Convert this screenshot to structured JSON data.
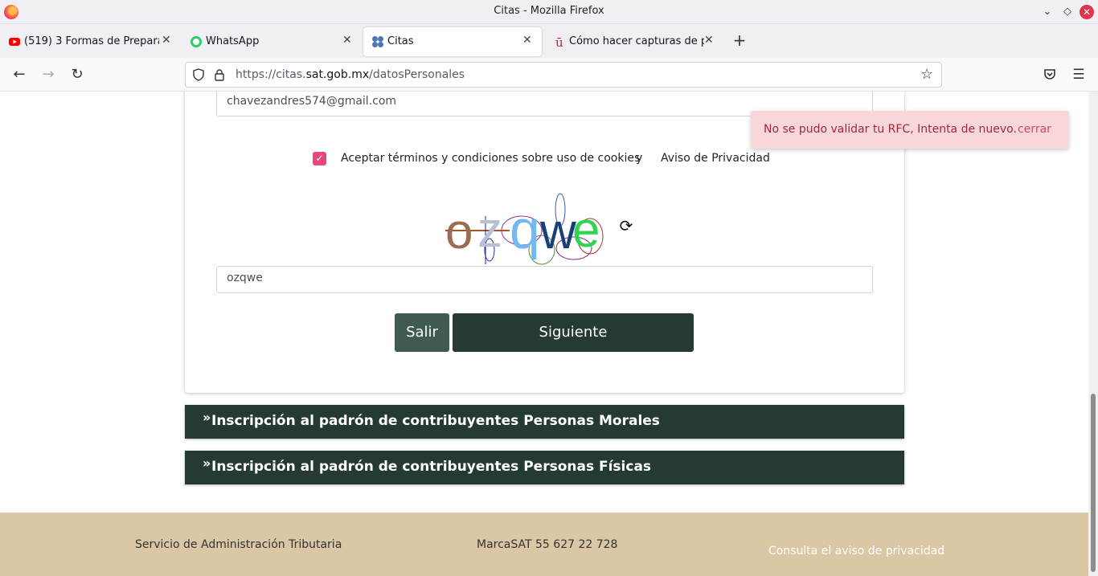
{
  "window": {
    "title": "Citas - Mozilla Firefox"
  },
  "tabs": [
    {
      "label": "(519) 3 Formas de Prepara",
      "icon": "youtube-icon"
    },
    {
      "label": "WhatsApp",
      "icon": "whatsapp-icon"
    },
    {
      "label": "Citas",
      "icon": "citas-icon",
      "active": true
    },
    {
      "label": "Cómo hacer capturas de p",
      "icon": "site-icon"
    }
  ],
  "urlbar": {
    "prefix": "https://citas.",
    "domain": "sat.gob.mx",
    "path": "/datosPersonales"
  },
  "form": {
    "email_value": "chavezandres574@gmail.com",
    "terms_text": "Aceptar términos y condiciones sobre uso de cookies",
    "terms_connector": "y",
    "privacy_link": "Aviso de Privacidad",
    "captcha_text": "ozqwe",
    "captcha_value": "ozqwe",
    "salir_label": "Salir",
    "siguiente_label": "Siguiente"
  },
  "accordions": [
    {
      "label": "Inscripción al padrón de contribuyentes Personas Morales"
    },
    {
      "label": "Inscripción al padrón de contribuyentes Personas Físicas"
    }
  ],
  "footer": {
    "org": "Servicio de Administración Tributaria",
    "phone": "MarcaSAT 55 627 22 728",
    "privacy": "Consulta el aviso de privacidad"
  },
  "toast": {
    "message": "No se pudo validar tu RFC, Intenta de nuevo.",
    "close_label": "cerrar"
  },
  "colors": {
    "accent": "#253a31",
    "checkbox": "#e8467c",
    "footer": "#dbc7a5",
    "toast_bg": "#f8d7da"
  }
}
